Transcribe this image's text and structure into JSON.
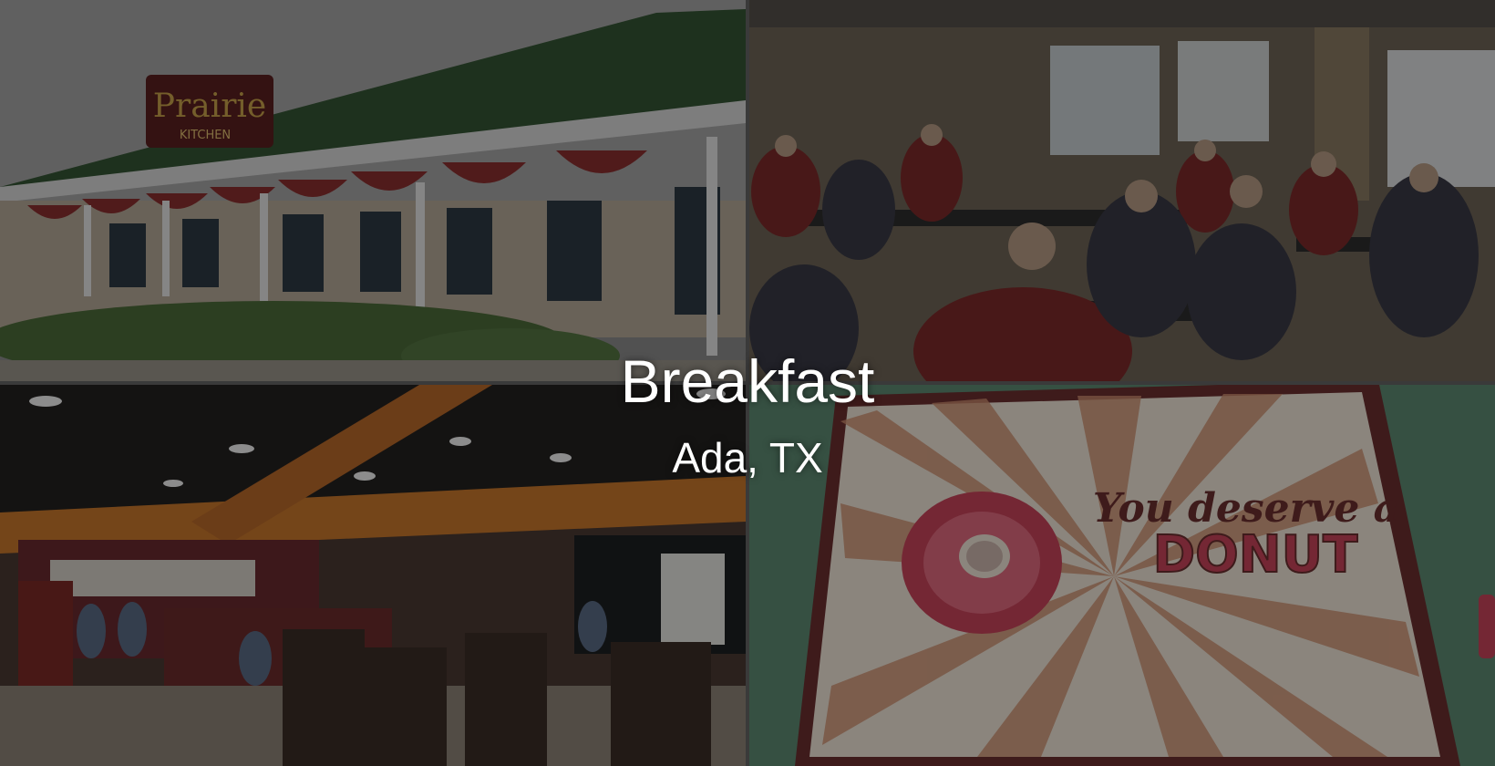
{
  "slide": {
    "title": "Breakfast",
    "subtitle": "Ada, TX"
  },
  "photos": {
    "exterior": {
      "sign_text": "Prairie",
      "sign_subtext": "KITCHEN"
    },
    "placemat": {
      "line1": "You deserve a",
      "line2": "DONUT"
    }
  },
  "colors": {
    "overlay_text": "#ffffff",
    "donut_pink": "#c8445a",
    "sign_gold": "#c9a24a",
    "restaurant_orange": "#c9772b"
  }
}
